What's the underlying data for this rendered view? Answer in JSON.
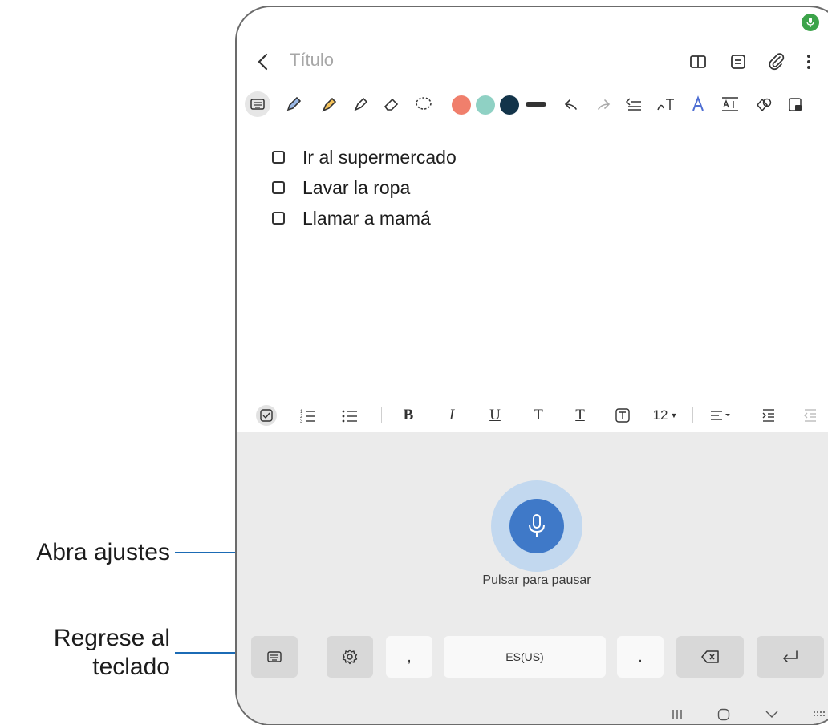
{
  "note": {
    "title_placeholder": "Título",
    "checklist": [
      {
        "text": "Ir al supermercado",
        "checked": false
      },
      {
        "text": "Lavar la ropa",
        "checked": false
      },
      {
        "text": "Llamar a mamá",
        "checked": false
      }
    ]
  },
  "pen_toolbar": {
    "colors": [
      "#f07f6c",
      "#8fd1c4",
      "#13344a"
    ]
  },
  "format_toolbar": {
    "bold_label": "B",
    "italic_label": "I",
    "underline_label": "U",
    "strike_label": "T",
    "font_color_label": "T",
    "font_size": "12"
  },
  "voice": {
    "pause_label": "Pulsar para pausar",
    "comma_label": ",",
    "language_label": "ES(US)",
    "period_label": "."
  },
  "callouts": {
    "settings": "Abra ajustes",
    "keyboard_line1": "Regrese al",
    "keyboard_line2": "teclado"
  },
  "colors": {
    "mic_accent": "#3f79c8",
    "callout_line": "#1b6bb5",
    "status_mic": "#3ca34a"
  }
}
